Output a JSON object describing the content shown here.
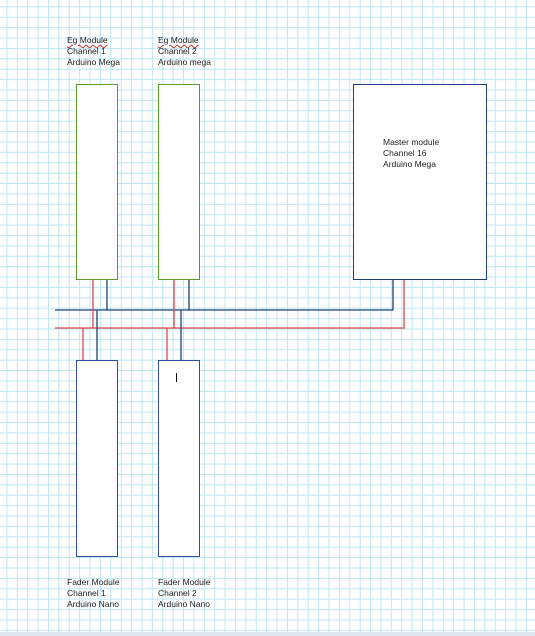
{
  "modules": {
    "eg1": {
      "line1": "Eg Module",
      "line2": "Channel 1",
      "line3": "Arduino Mega"
    },
    "eg2": {
      "line1": "Eg Module",
      "line2": "Channel 2",
      "line3": "Arduino mega"
    },
    "master": {
      "line1": "Master module",
      "line2": "Channel 16",
      "line3": "Arduino Mega"
    },
    "fader1": {
      "line1": "Fader Module",
      "line2": "Channel 1",
      "line3": "Arduino Nano"
    },
    "fader2": {
      "line1": "Fader Module",
      "line2": "Channel 2",
      "line3": "Arduino Nano"
    }
  },
  "colors": {
    "eg_border": "#5b9a2c",
    "fader_border": "#2f4f9e",
    "master_border": "#1f3f7a",
    "red_wire": "#e2444a",
    "blue_wire": "#1f3f7a",
    "grid": "#bfe6f2"
  }
}
